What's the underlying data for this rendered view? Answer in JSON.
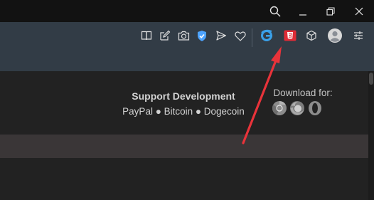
{
  "window": {
    "icons": [
      "search-icon",
      "minimize-icon",
      "restore-icon",
      "close-icon"
    ]
  },
  "toolbar": {
    "icons": [
      "reading-view-icon",
      "edit-icon",
      "camera-icon",
      "shield-check-icon",
      "send-icon",
      "heart-icon",
      "edge-icon",
      "html5-icon",
      "box-icon",
      "avatar",
      "settings-sliders-icon"
    ],
    "accent_shield": "#4da3ff",
    "accent_edge": "#3aa0e8",
    "accent_html5": "#e02b36"
  },
  "support": {
    "title": "Support Development",
    "links_text": "PayPal ● Bitcoin ● Dogecoin"
  },
  "download": {
    "label": "Download for:",
    "browsers": [
      "chrome-icon",
      "firefox-icon",
      "opera-icon"
    ]
  },
  "annotation": {
    "arrow_color": "#e8333a"
  }
}
